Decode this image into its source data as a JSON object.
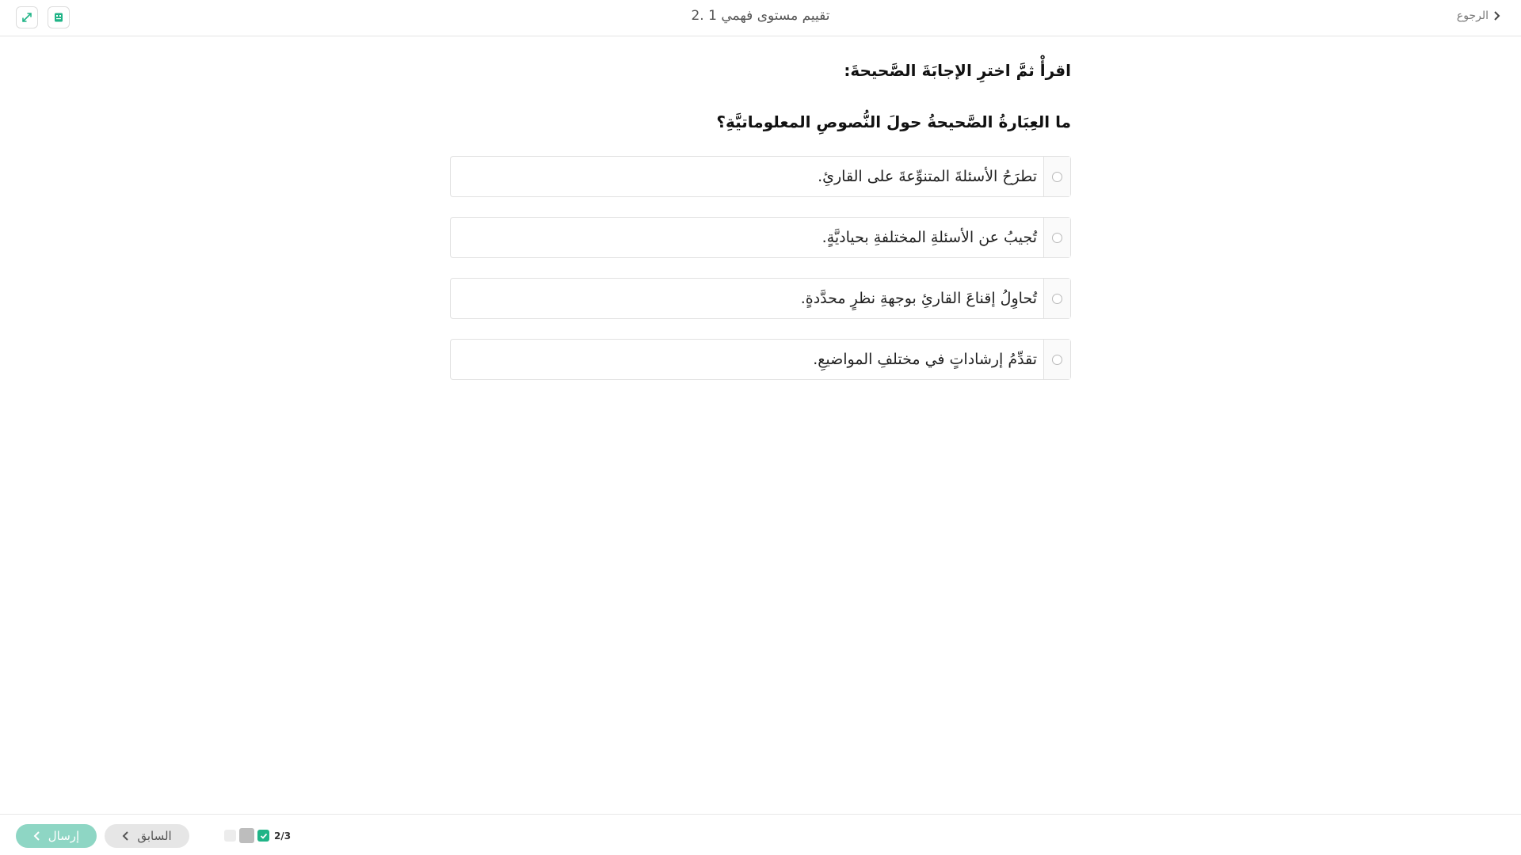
{
  "header": {
    "title": "2. تقييم مستوى فهمي 1",
    "back_label": "الرجوع"
  },
  "toolbar": {
    "expand_icon": "expand-arrows-icon",
    "doc_icon": "notebook-icon",
    "accent_color": "#20b487"
  },
  "main": {
    "instruction": "اقرأْ ثمَّ اخترِ الإجابَةَ الصَّحيحةَ:",
    "question": "ما العِبَارةُ الصَّحيحةُ حولَ النُّصوصِ المعلوماتيَّةِ؟",
    "options": [
      {
        "label": "تطرَحُ الأسئلةَ المتنوِّعةَ على القارئِ.",
        "selected": false
      },
      {
        "label": "تُجيبُ عن الأسئلةِ المختلفةِ بحياديَّةٍ.",
        "selected": false
      },
      {
        "label": "تُحاوِلُ إقناعَ القارئِ بوجهةِ نظرٍ محدَّدةٍ.",
        "selected": false
      },
      {
        "label": "تقدِّمُ إرشاداتٍ في مختلفِ المواضيعِ.",
        "selected": false
      }
    ]
  },
  "footer": {
    "submit_label": "إرسال",
    "prev_label": "السابق",
    "progress_label": "2/3",
    "progress": {
      "answered": 2,
      "total": 3
    }
  }
}
